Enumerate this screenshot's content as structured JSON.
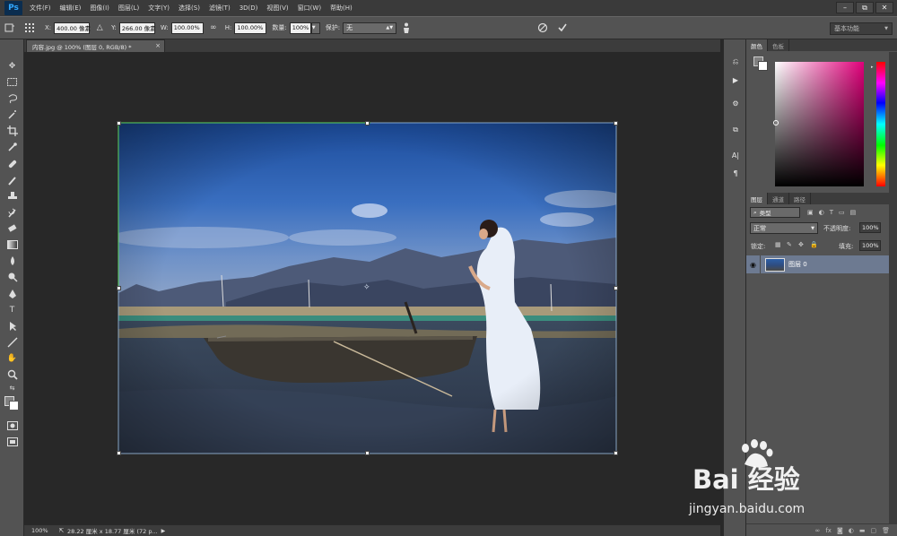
{
  "menubar": {
    "logo": "Ps",
    "items": [
      "文件(F)",
      "编辑(E)",
      "图像(I)",
      "图层(L)",
      "文字(Y)",
      "选择(S)",
      "滤镜(T)",
      "3D(D)",
      "视图(V)",
      "窗口(W)",
      "帮助(H)"
    ]
  },
  "window_controls": {
    "minimize": "–",
    "restore": "⧉",
    "close": "✕"
  },
  "options": {
    "x_label": "X:",
    "x_value": "400.00 像素",
    "y_label": "Y:",
    "y_value": "266.00 像素",
    "w_label": "W:",
    "w_value": "100.00%",
    "h_label": "H:",
    "h_value": "100.00%",
    "count_label": "数量:",
    "count_value": "100%",
    "protect_label": "保护:",
    "protect_value": "无",
    "workspace": "基本功能"
  },
  "document": {
    "tab_title": "内容.jpg @ 100% (图层 0, RGB/8) *",
    "close": "×"
  },
  "statusbar": {
    "zoom": "100%",
    "info": "28.22 厘米 x 18.77 厘米 (72 p..."
  },
  "color_panel": {
    "tabs": [
      "颜色",
      "色板"
    ],
    "accent": "#e0007a"
  },
  "layers_panel": {
    "tabs": [
      "图层",
      "通道",
      "路径"
    ],
    "filter_kind": "类型",
    "blend_mode": "正常",
    "opacity_label": "不透明度:",
    "opacity_value": "100%",
    "lock_label": "锁定:",
    "fill_label": "填充:",
    "fill_value": "100%",
    "layers": [
      {
        "name": "图层 0",
        "visible": true
      }
    ]
  },
  "watermark": {
    "brand": "Bai 经验",
    "url": "jingyan.baidu.com"
  }
}
